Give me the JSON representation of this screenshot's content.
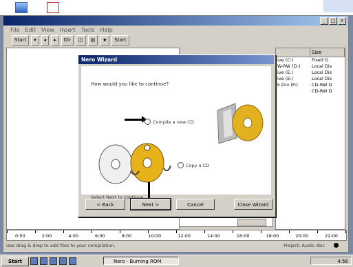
{
  "window": {
    "title": "",
    "title_buttons": [
      "_",
      "□",
      "×"
    ]
  },
  "menu": [
    "File",
    "Edit",
    "View",
    "Insert",
    "Tools",
    "Help"
  ],
  "toolbar": {
    "items": [
      "Start",
      "▾",
      "◂",
      "▸",
      "Dir",
      "◫",
      "▤",
      "★",
      "Start"
    ]
  },
  "right_list": {
    "headers": [
      "",
      "Size"
    ],
    "rows": [
      [
        "ive (C:)",
        "Fixed D"
      ],
      [
        "W-RW (D:)",
        "Local Dis"
      ],
      [
        "ive (E:)",
        "Local Dis"
      ],
      [
        "ive (E:)",
        "Local Dis"
      ],
      [
        "k Drv (F:)",
        "CD-RW D"
      ],
      [
        "",
        "CD-RW D"
      ]
    ]
  },
  "ruler": {
    "labels": [
      "0:00",
      "2:00",
      "4:00",
      "6:00",
      "8:00",
      "10:00",
      "12:00",
      "14:00",
      "16:00",
      "18:00",
      "20:00",
      "22:00"
    ]
  },
  "status": {
    "left": "Use drag & drop to add files to your compilation.",
    "right": "Project: Audio disc"
  },
  "taskbar": {
    "start": "Start",
    "task": "Nero - Burning ROM",
    "clock": "4:56"
  },
  "dialog": {
    "title": "Nero Wizard",
    "question": "How would you like to continue?",
    "option1": "Compile a new CD",
    "option2": "Copy a CD",
    "footer": "Select Next to continue.",
    "buttons": {
      "back": "< Back",
      "next": "Next >",
      "cancel": "Cancel",
      "finish": "Close Wizard"
    }
  },
  "colors": {
    "titlebar_start": "#0a246a",
    "titlebar_end": "#a6caf0",
    "face": "#d4d0c8"
  }
}
